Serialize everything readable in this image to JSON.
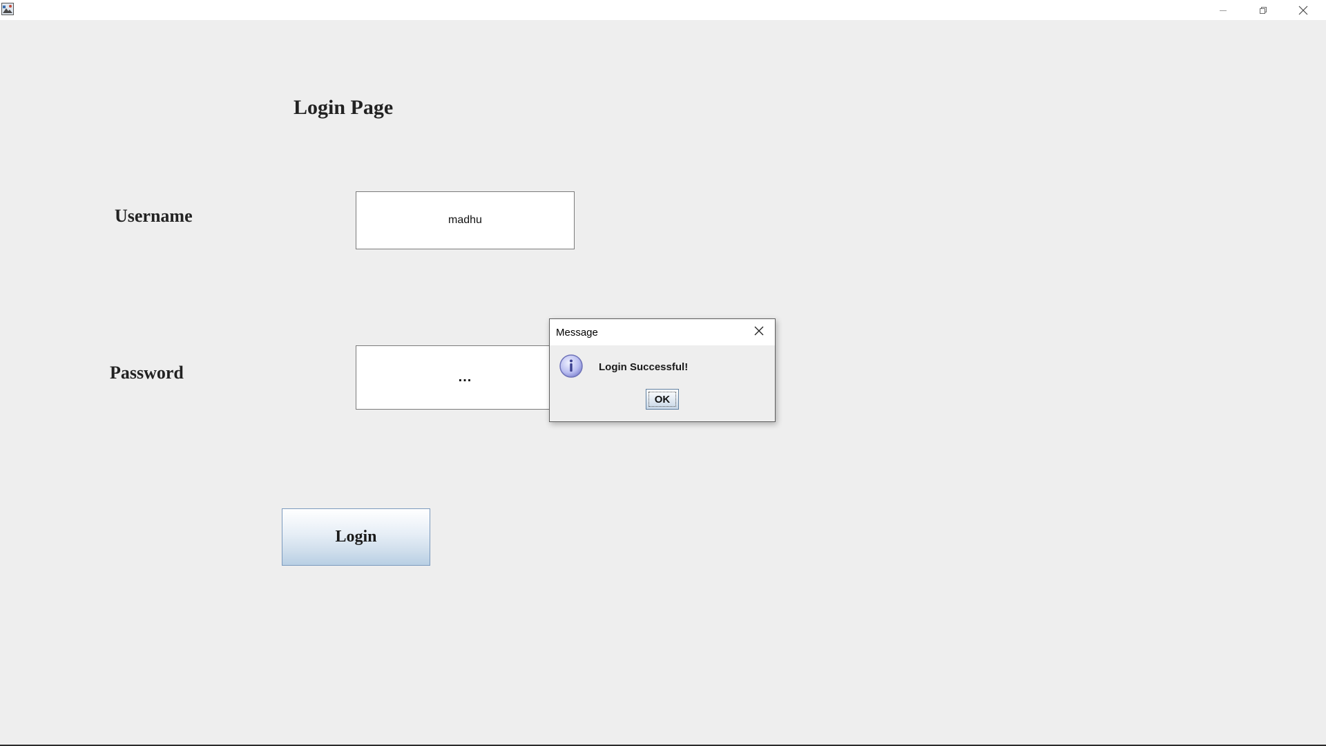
{
  "window": {
    "icon": "java-app-icon",
    "controls": {
      "minimize_icon": "minimize-icon",
      "maximize_icon": "restore-icon",
      "close_icon": "close-icon"
    }
  },
  "main": {
    "heading": "Login Page",
    "username_label": "Username",
    "username_value": "madhu",
    "password_label": "Password",
    "password_value": "...",
    "login_button": "Login"
  },
  "dialog": {
    "title": "Message",
    "message": "Login Successful!",
    "ok_label": "OK",
    "icon": "information-icon",
    "close_icon": "close-icon"
  },
  "colors": {
    "background": "#eeeeee",
    "titlebar": "#ffffff",
    "button_gradient_top": "#ffffff",
    "button_gradient_bottom": "#b8cfe4",
    "info_icon": "#8a8fd6"
  }
}
